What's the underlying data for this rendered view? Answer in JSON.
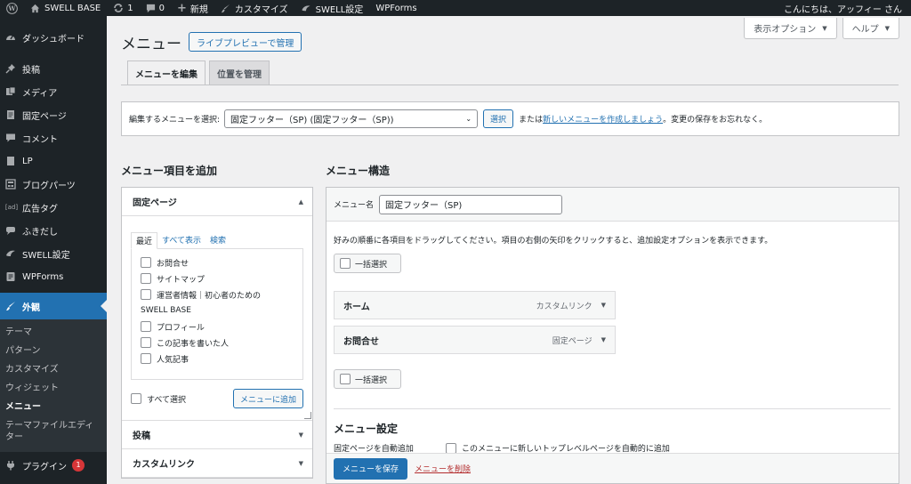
{
  "adminbar": {
    "site_name": "SWELL BASE",
    "updates_count": "1",
    "comments_count": "0",
    "new_label": "新規",
    "customize_label": "カスタマイズ",
    "swell_label": "SWELL設定",
    "wpforms_label": "WPForms",
    "greeting": "こんにちは、アッフィー さん"
  },
  "sidebar": {
    "items": [
      {
        "label": "ダッシュボード",
        "icon": "dashboard-icon"
      },
      {
        "label": "投稿",
        "icon": "pin-icon"
      },
      {
        "label": "メディア",
        "icon": "media-icon"
      },
      {
        "label": "固定ページ",
        "icon": "page-icon"
      },
      {
        "label": "コメント",
        "icon": "comment-icon"
      },
      {
        "label": "LP",
        "icon": "lp-icon"
      },
      {
        "label": "ブログパーツ",
        "icon": "blogparts-icon"
      },
      {
        "label": "広告タグ",
        "icon": "ad-icon",
        "icon_text": "[ad]"
      },
      {
        "label": "ふきだし",
        "icon": "balloon-icon"
      },
      {
        "label": "SWELL設定",
        "icon": "swell-icon"
      },
      {
        "label": "WPForms",
        "icon": "wpforms-icon"
      }
    ],
    "current": {
      "label": "外観",
      "icon": "appearance-icon"
    },
    "submenu": [
      "テーマ",
      "パターン",
      "カスタマイズ",
      "ウィジェット",
      "メニュー",
      "テーマファイルエディター"
    ],
    "plugins": {
      "label": "プラグイン",
      "badge": "1"
    }
  },
  "header": {
    "title": "メニュー",
    "live_preview_btn": "ライブプレビューで管理",
    "screen_options": "表示オプション",
    "help": "ヘルプ"
  },
  "tabs": {
    "edit": "メニューを編集",
    "locations": "位置を管理"
  },
  "select_bar": {
    "label": "編集するメニューを選択:",
    "selected": "固定フッター（SP) (固定フッター（SP))",
    "select_btn": "選択",
    "or_text": "または",
    "create_link": "新しいメニューを作成しましょう",
    "after_text": "。変更の保存をお忘れなく。"
  },
  "add_items": {
    "title": "メニュー項目を追加",
    "panel_title": "固定ページ",
    "subtabs": [
      "最近",
      "すべて表示",
      "検索"
    ],
    "pages": [
      "お問合せ",
      "サイトマップ",
      "運営者情報｜初心者のための"
    ],
    "group_label": "SWELL BASE",
    "group_pages": [
      "プロフィール",
      "この記事を書いた人",
      "人気記事"
    ],
    "select_all": "すべて選択",
    "add_btn": "メニューに追加",
    "posts_title": "投稿",
    "custom_links_title": "カスタムリンク"
  },
  "structure": {
    "title": "メニュー構造",
    "name_label": "メニュー名",
    "name_value": "固定フッター（SP)",
    "instructions": "好みの順番に各項目をドラッグしてください。項目の右側の矢印をクリックすると、追加設定オプションを表示できます。",
    "bulk_select": "一括選択",
    "items": [
      {
        "title": "ホーム",
        "type": "カスタムリンク"
      },
      {
        "title": "お問合せ",
        "type": "固定ページ"
      }
    ],
    "settings_title": "メニュー設定",
    "auto_add_label": "固定ページを自動追加",
    "auto_add_option": "このメニューに新しいトップレベルページを自動的に追加",
    "save_btn": "メニューを保存",
    "delete_link": "メニューを削除"
  },
  "colors": {
    "accent": "#2271b1",
    "sidebar_bg": "#1d2327",
    "danger": "#d63638"
  }
}
